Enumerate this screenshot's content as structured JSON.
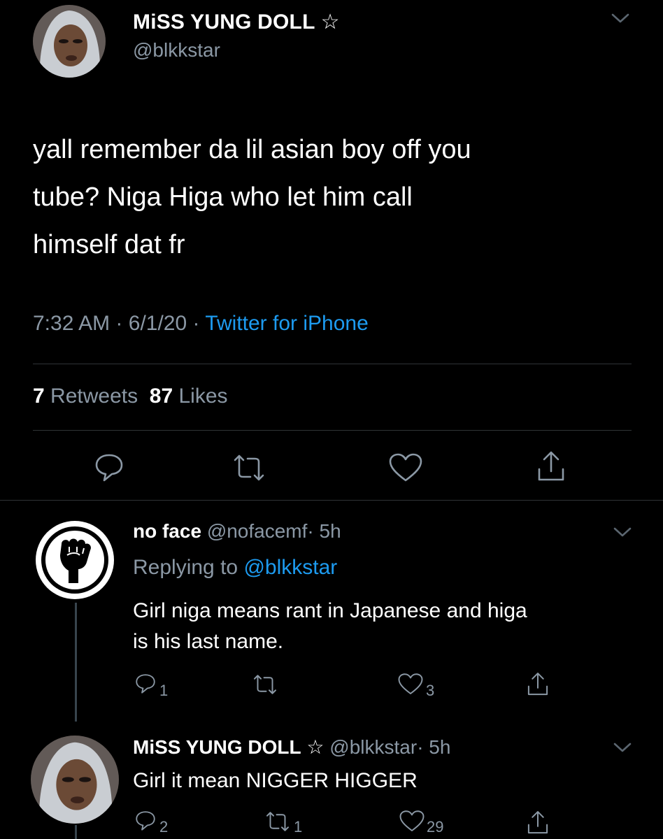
{
  "main_tweet": {
    "display_name": "MiSS YUNG DOLL",
    "name_badge": "☆",
    "handle": "@blkkstar",
    "text": "yall remember da lil asian boy off  you\ntube? Niga Higa who let him call\nhimself dat fr",
    "time": "7:32 AM",
    "date": "6/1/20",
    "sep": "·",
    "source": "Twitter for iPhone",
    "retweets_count": "7",
    "retweets_label": "Retweets",
    "likes_count": "87",
    "likes_label": "Likes"
  },
  "replies": [
    {
      "display_name": "no face",
      "handle": "@nofacemf",
      "age": "· 5h",
      "replying_label": "Replying to",
      "replying_to": "@blkkstar",
      "text": "Girl niga means rant in Japanese and higa\nis his last name.",
      "reply_count": "1",
      "retweet_count": "",
      "like_count": "3"
    },
    {
      "display_name": "MiSS YUNG DOLL",
      "name_badge": "☆",
      "handle": "@blkkstar",
      "age": "· 5h",
      "text": "Girl it mean NIGGER HIGGER",
      "reply_count": "2",
      "retweet_count": "1",
      "like_count": "29"
    }
  ],
  "icons": [
    "chevron-down-icon",
    "reply-icon",
    "retweet-icon",
    "like-icon",
    "share-icon",
    "raised-fist-icon"
  ],
  "colors": {
    "background": "#000000",
    "text": "#e6e9ec",
    "muted": "#8b98a5",
    "link": "#1d9bf0",
    "divider": "#2f3336"
  }
}
